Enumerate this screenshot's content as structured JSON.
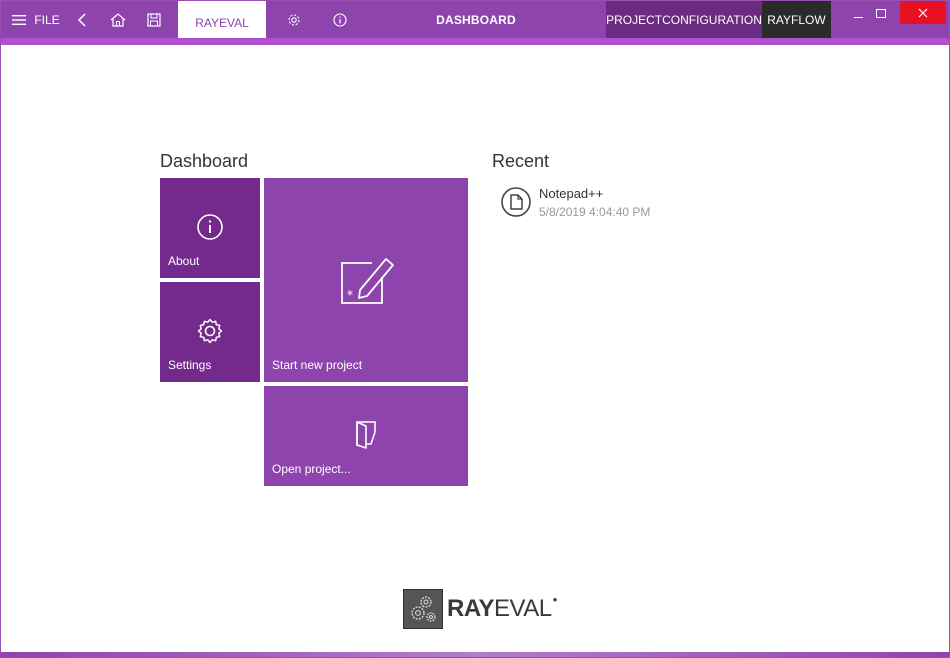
{
  "titlebar": {
    "file_label": "FILE",
    "tab_label": "RAYEVAL",
    "title": "DASHBOARD",
    "project_configuration": "PROJECTCONFIGURATION",
    "rayflow": "RAYFLOW",
    "icons": [
      "menu-icon",
      "back-icon",
      "home-icon",
      "save-icon",
      "gear-icon",
      "info-icon",
      "minimize-icon",
      "maximize-icon",
      "close-icon"
    ]
  },
  "dashboard": {
    "heading": "Dashboard",
    "tiles": {
      "about": "About",
      "settings": "Settings",
      "start_new_project": "Start new project",
      "open_project": "Open project..."
    }
  },
  "recent": {
    "heading": "Recent",
    "items": [
      {
        "name": "Notepad++",
        "timestamp": "5/8/2019 4:04:40 PM"
      }
    ]
  },
  "logo": {
    "text_bold": "RAY",
    "text_light": "EVAL"
  },
  "colors": {
    "accent": "#8e44ad",
    "accent_dark": "#732a8c",
    "project_config_bg": "#6a2b80",
    "rayflow_bg": "#2b2b2b",
    "close_bg": "#e81123"
  }
}
